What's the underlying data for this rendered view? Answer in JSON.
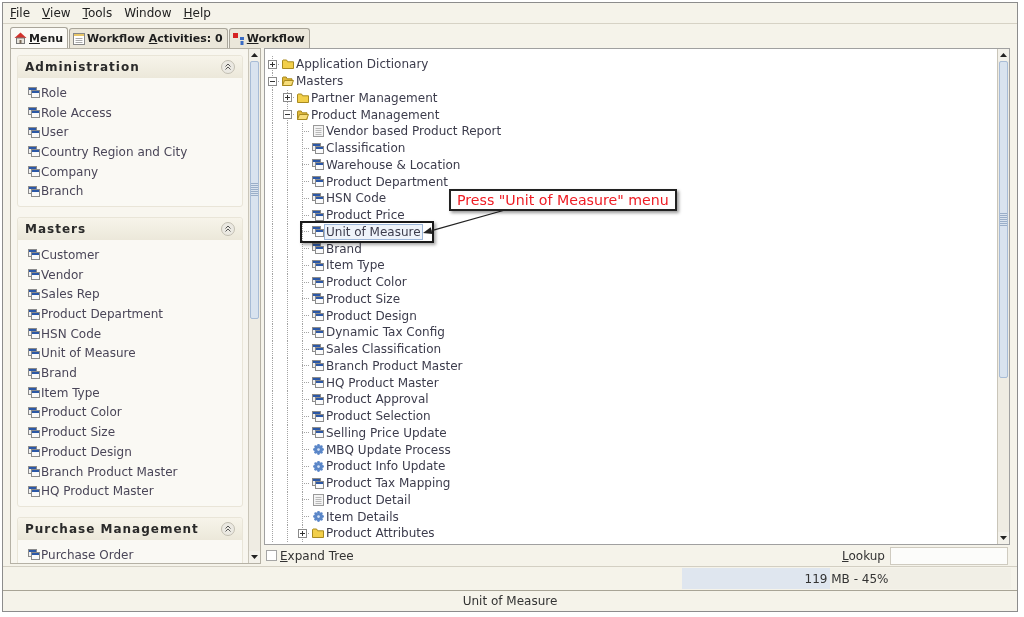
{
  "menu_bar": [
    {
      "mnemonic": "F",
      "label_end": "ile"
    },
    {
      "mnemonic": "V",
      "label_end": "iew"
    },
    {
      "mnemonic": "T",
      "label_end": "ools"
    },
    {
      "label_start": "Window"
    },
    {
      "mnemonic": "H",
      "label_end": "elp"
    }
  ],
  "tabs": [
    {
      "kind": "menu",
      "mnemonic": "M",
      "label_end": "enu",
      "selected": true
    },
    {
      "kind": "activities",
      "label_start": "Workflow ",
      "mnemonic": "A",
      "label_end": "ctivities: 0",
      "selected": false
    },
    {
      "kind": "workflow",
      "mnemonic": "W",
      "label_end": "orkflow",
      "selected": false
    }
  ],
  "sidebar": {
    "sections": [
      {
        "title": "Administration",
        "expanded": true,
        "items": [
          "Role",
          "Role Access",
          "User",
          "Country Region and City",
          "Company",
          "Branch"
        ]
      },
      {
        "title": "Masters",
        "expanded": true,
        "items": [
          "Customer",
          "Vendor",
          "Sales Rep",
          "Product Department",
          "HSN Code",
          "Unit of Measure",
          "Brand",
          "Item Type",
          "Product Color",
          "Product Size",
          "Product Design",
          "Branch Product Master",
          "HQ Product Master"
        ]
      },
      {
        "title": "Purchase Management",
        "expanded": true,
        "items": [
          "Purchase Order"
        ]
      }
    ]
  },
  "tree": {
    "nodes": [
      {
        "label": "Application Dictionary",
        "kind": "folder",
        "expanded": false,
        "selected": false
      },
      {
        "label": "Masters",
        "kind": "folder",
        "expanded": true,
        "selected": false,
        "children": [
          {
            "label": "Partner Management",
            "kind": "folder",
            "expanded": false,
            "selected": false
          },
          {
            "label": "Product Management",
            "kind": "folder",
            "expanded": true,
            "selected": false,
            "children": [
              {
                "label": "Vendor based Product Report",
                "kind": "report",
                "selected": false
              },
              {
                "label": "Classification",
                "kind": "window",
                "selected": false
              },
              {
                "label": "Warehouse & Location",
                "kind": "window",
                "selected": false
              },
              {
                "label": "Product Department",
                "kind": "window",
                "selected": false
              },
              {
                "label": "HSN Code",
                "kind": "window",
                "selected": false
              },
              {
                "label": "Product Price",
                "kind": "window",
                "selected": false
              },
              {
                "label": "Unit of Measure",
                "kind": "window",
                "selected": true
              },
              {
                "label": "Brand",
                "kind": "window",
                "selected": false
              },
              {
                "label": "Item Type",
                "kind": "window",
                "selected": false
              },
              {
                "label": "Product Color",
                "kind": "window",
                "selected": false
              },
              {
                "label": "Product Size",
                "kind": "window",
                "selected": false
              },
              {
                "label": "Product Design",
                "kind": "window",
                "selected": false
              },
              {
                "label": "Dynamic Tax Config",
                "kind": "window",
                "selected": false
              },
              {
                "label": "Sales Classification",
                "kind": "window",
                "selected": false
              },
              {
                "label": "Branch Product Master",
                "kind": "window",
                "selected": false
              },
              {
                "label": "HQ Product Master",
                "kind": "window",
                "selected": false
              },
              {
                "label": "Product Approval",
                "kind": "window",
                "selected": false
              },
              {
                "label": "Product Selection",
                "kind": "window",
                "selected": false
              },
              {
                "label": "Selling Price Update",
                "kind": "window",
                "selected": false
              },
              {
                "label": "MBQ Update Process",
                "kind": "process",
                "selected": false
              },
              {
                "label": "Product Info Update",
                "kind": "process",
                "selected": false
              },
              {
                "label": "Product Tax Mapping",
                "kind": "window",
                "selected": false
              },
              {
                "label": "Product Detail",
                "kind": "report",
                "selected": false
              },
              {
                "label": "Item Details",
                "kind": "process",
                "selected": false
              },
              {
                "label": "Product Attributes",
                "kind": "folder",
                "expanded": false,
                "selected": false
              }
            ]
          }
        ]
      }
    ]
  },
  "annotation": {
    "text": "Press \"Unit of Measure\" menu"
  },
  "expand_tree": {
    "mnemonic": "E",
    "label_end": "xpand Tree",
    "checked": false
  },
  "lookup": {
    "mnemonic": "L",
    "label_end": "ookup"
  },
  "memory": {
    "reading": "119 MB - 45%",
    "level": 0.45
  },
  "status_bar": {
    "text": "Unit of Measure"
  }
}
